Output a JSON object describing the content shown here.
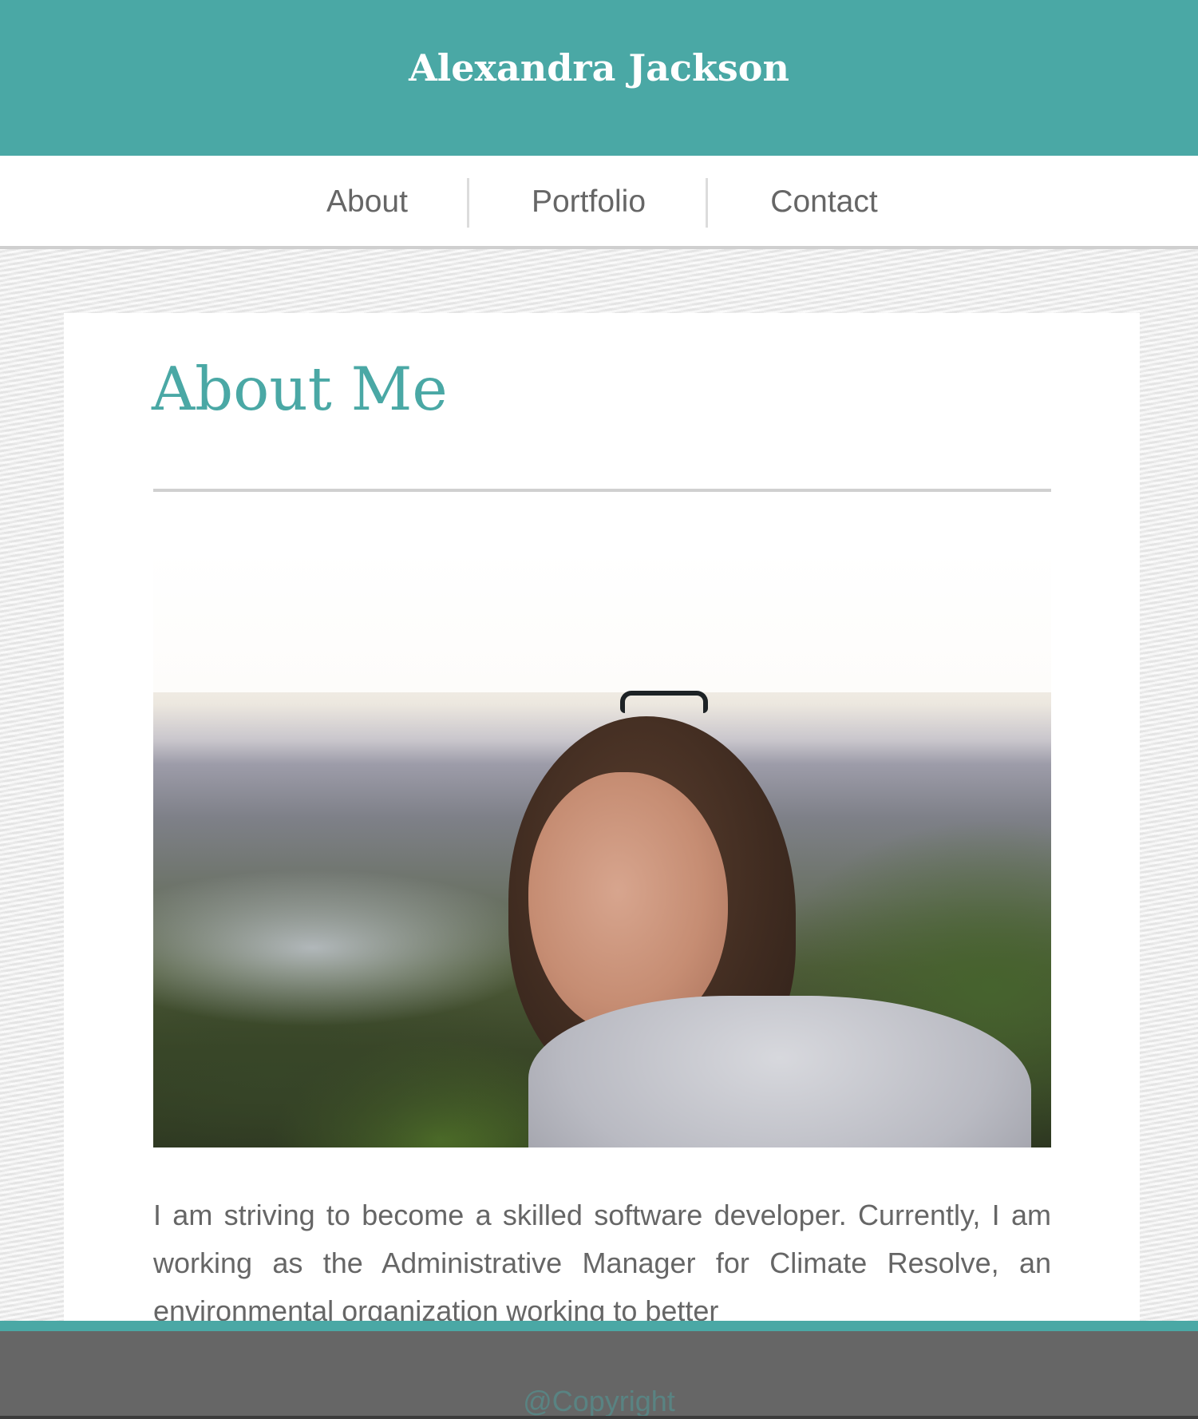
{
  "header": {
    "title": "Alexandra Jackson"
  },
  "nav": {
    "items": [
      {
        "label": "About"
      },
      {
        "label": "Portfolio"
      },
      {
        "label": "Contact"
      }
    ]
  },
  "main": {
    "heading": "About Me",
    "bio": "I am striving to become a skilled software developer. Currently, I am working as the Administrative Manager for Climate Resolve, an environmental organization working to better"
  },
  "footer": {
    "copyright": "@Copyright"
  },
  "colors": {
    "accent": "#4aa8a5",
    "text": "#666666",
    "footer_bg": "#666666"
  }
}
